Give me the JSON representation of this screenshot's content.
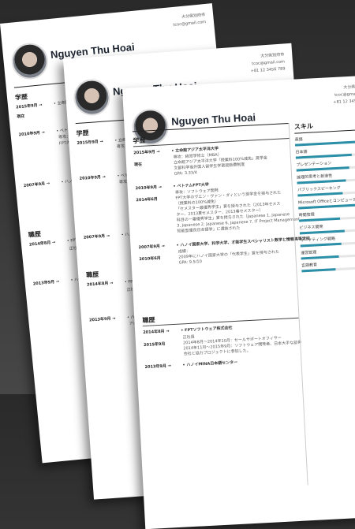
{
  "resume": {
    "name": "Nguyen Thu Hoai",
    "contact": [
      "大分県別府市",
      "tcoc@gmail.com",
      "+81 12 3456 789"
    ],
    "education_title": "学歴",
    "work_title": "職歴",
    "skills_title": "スキル",
    "education": [
      {
        "date": "2015年9月 →",
        "title": "• 立命館アジア太平洋大学",
        "lines": [
          "専攻：経営学修士（MBA）",
          "立命館アジア太平洋大学「授業料100%減免」奨学金",
          "文部科学省外国人留学生学習奨励費制度",
          "GPA: 3.33/4"
        ]
      },
      {
        "date": "現在",
        "title": "",
        "lines": []
      },
      {
        "date": "2010年9月 →",
        "title": "• ベトナムFPT大学",
        "lines": [
          "専攻：ソフトウェア開発",
          "FPT大学のヴエン・ヴァン・ダィという奨学金を授与された",
          "（授業料の100%減免）",
          "「セメスター最優秀学生」賞を授与された（2013年セメス",
          "ター、2013夏セメスター、2013春セメスター）"
        ]
      },
      {
        "date": "2014年6月",
        "title": "",
        "lines": [
          "科目の一番優秀学生」賞を授与された（Japanese 1, Japanese",
          "3, Japanese 2, Japanese 6, Japanese 7, IT Project Management",
          "知能型優良日本語学」に選抜された"
        ]
      },
      {
        "date": "2007年9月 →",
        "title": "• ハノイ国家大学、科学大学、才能学生スペシャリスト数学と情報高等学校",
        "lines": [
          "成績：",
          "2009年にハノイ国家大学の「代表学生」賞を授与された",
          "GPA: 9.5/10"
        ]
      },
      {
        "date": "2010年6月",
        "title": "",
        "lines": []
      }
    ],
    "work": [
      {
        "date": "2014年8月 →",
        "title": "• FPTソフトウェア株式会社",
        "lines": [
          "正社員",
          "2014年8月～2014年10月：セールサポートオフィサー",
          "2014年11月～2015年9月：ソフトウェア開発者、日本大手な証券",
          "会社と協力プロジェクトに参加した。"
        ]
      },
      {
        "date": "2015年9月",
        "title": "",
        "lines": []
      },
      {
        "date": "2013年9月 →",
        "title": "• ハノイMINA日本語センター",
        "lines": [
          "アルバイト"
        ]
      }
    ],
    "skills": [
      {
        "label": "英語",
        "level": 0.8
      },
      {
        "label": "日本語",
        "level": 0.75
      },
      {
        "label": "プレゼンテーション",
        "level": 0.7
      },
      {
        "label": "論理的思考と創造性",
        "level": 0.65
      },
      {
        "label": "パブリックスピーキング",
        "level": 0.6
      },
      {
        "label": "Microsoft Officeとコンピューター",
        "level": 0.85
      },
      {
        "label": "時間管理",
        "level": 0.55
      },
      {
        "label": "ビジネス開発",
        "level": 0.6
      },
      {
        "label": "マーケティング戦略",
        "level": 0.55
      },
      {
        "label": "運営管理",
        "level": 0.5
      },
      {
        "label": "言語教育",
        "level": 0.45
      }
    ],
    "accent_colors": {
      "pink": "#d24b8a",
      "teal": "#26a6b3",
      "bar": "#2b8fa7"
    }
  }
}
